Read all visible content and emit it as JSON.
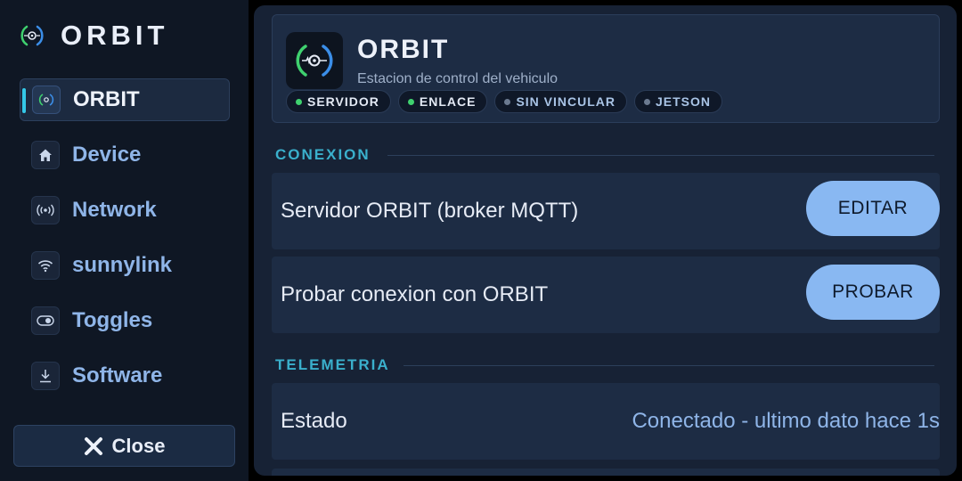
{
  "sidebar": {
    "brand": "ORBIT",
    "items": [
      {
        "label": "ORBIT",
        "icon": "orbit-icon",
        "active": true
      },
      {
        "label": "Device",
        "icon": "home-icon",
        "active": false
      },
      {
        "label": "Network",
        "icon": "broadcast-icon",
        "active": false
      },
      {
        "label": "sunnylink",
        "icon": "wifi-icon",
        "active": false
      },
      {
        "label": "Toggles",
        "icon": "toggle-icon",
        "active": false
      },
      {
        "label": "Software",
        "icon": "download-icon",
        "active": false
      }
    ],
    "close_label": "Close"
  },
  "header": {
    "title": "ORBIT",
    "subtitle": "Estacion de control del vehiculo",
    "chips": [
      {
        "label": "SERVIDOR",
        "status": "on",
        "color": "#3fd16f"
      },
      {
        "label": "ENLACE",
        "status": "on",
        "color": "#3fd16f"
      },
      {
        "label": "SIN VINCULAR",
        "status": "off",
        "color": "#6b7a90"
      },
      {
        "label": "JETSON",
        "status": "off",
        "color": "#6b7a90"
      }
    ]
  },
  "sections": {
    "conexion": {
      "title": "CONEXION",
      "rows": [
        {
          "label": "Servidor ORBIT (broker MQTT)",
          "button": "EDITAR"
        },
        {
          "label": "Probar conexion con ORBIT",
          "button": "PROBAR"
        }
      ]
    },
    "telemetria": {
      "title": "TELEMETRIA",
      "rows": [
        {
          "label": "Estado",
          "value": "Conectado - ultimo dato hace 1s"
        }
      ]
    }
  },
  "colors": {
    "accent": "#34c8e8",
    "button": "#89b8f2",
    "section_title": "#3ab0cc",
    "status_on": "#3fd16f",
    "status_off": "#6b7a90"
  }
}
